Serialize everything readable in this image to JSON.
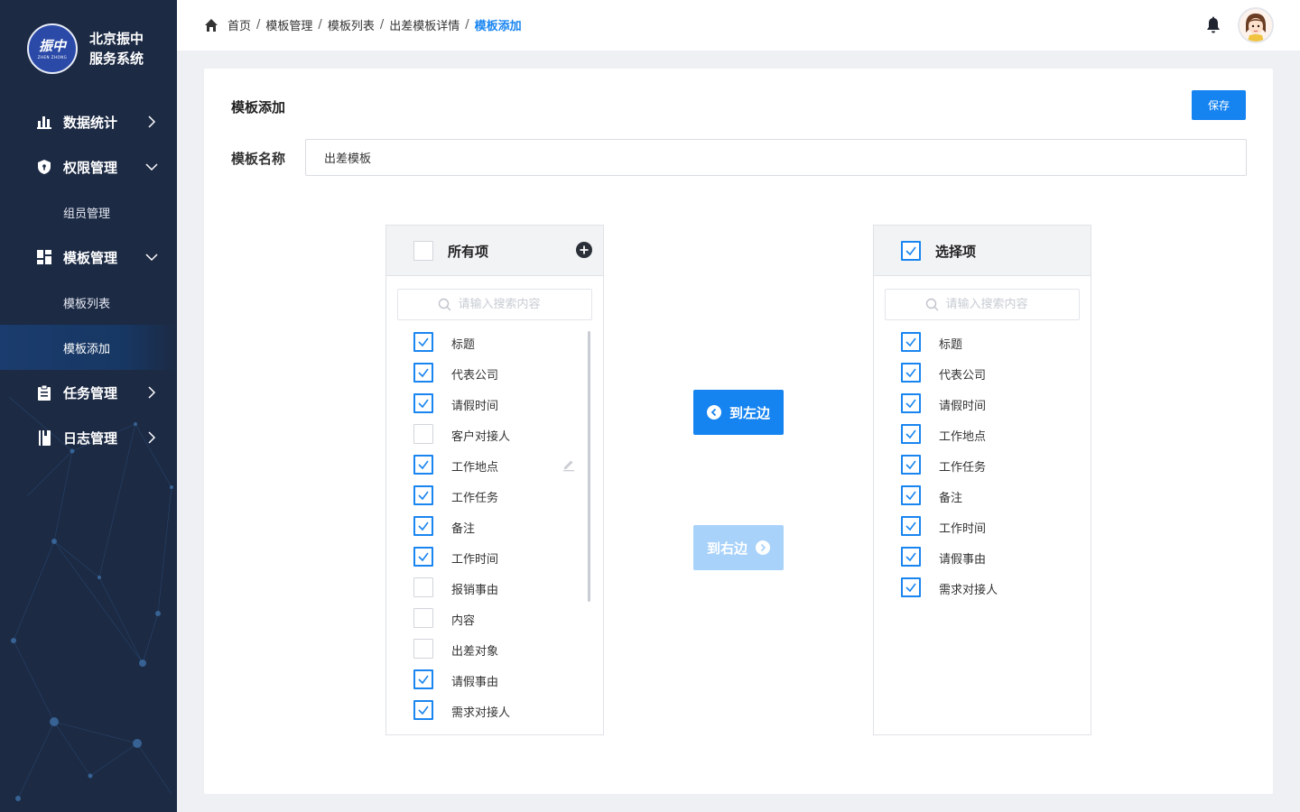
{
  "brand": {
    "logo_text": "振中",
    "logo_sub": "ZHEN ZHONG",
    "line1": "北京振中",
    "line2": "服务系统"
  },
  "sidebar": {
    "items": [
      {
        "label": "数据统计",
        "icon": "bar-chart-icon"
      },
      {
        "label": "权限管理",
        "icon": "shield-icon"
      },
      {
        "label": "组员管理"
      },
      {
        "label": "模板管理",
        "icon": "grid-icon"
      },
      {
        "label": "模板列表"
      },
      {
        "label": "模板添加",
        "active": true
      },
      {
        "label": "任务管理",
        "icon": "clipboard-icon"
      },
      {
        "label": "日志管理",
        "icon": "notebook-icon"
      }
    ]
  },
  "breadcrumb": {
    "items": [
      "首页",
      "模板管理",
      "模板列表",
      "出差模板详情"
    ],
    "current": "模板添加",
    "separator": "/"
  },
  "page": {
    "title": "模板添加",
    "save_label": "保存",
    "name_label": "模板名称",
    "name_value": "出差模板"
  },
  "left_panel": {
    "title": "所有项",
    "search_placeholder": "请输入搜索内容",
    "items": [
      {
        "label": "标题",
        "checked": true
      },
      {
        "label": "代表公司",
        "checked": true
      },
      {
        "label": "请假时间",
        "checked": true
      },
      {
        "label": "客户对接人",
        "checked": false
      },
      {
        "label": "工作地点",
        "checked": true
      },
      {
        "label": "工作任务",
        "checked": true
      },
      {
        "label": "备注",
        "checked": true
      },
      {
        "label": "工作时间",
        "checked": true
      },
      {
        "label": "报销事由",
        "checked": false
      },
      {
        "label": "内容",
        "checked": false
      },
      {
        "label": "出差对象",
        "checked": false
      },
      {
        "label": "请假事由",
        "checked": true
      },
      {
        "label": "需求对接人",
        "checked": true
      }
    ]
  },
  "right_panel": {
    "title": "选择项",
    "search_placeholder": "请输入搜索内容",
    "items": [
      {
        "label": "标题",
        "checked": true
      },
      {
        "label": "代表公司",
        "checked": true
      },
      {
        "label": "请假时间",
        "checked": true
      },
      {
        "label": "工作地点",
        "checked": true
      },
      {
        "label": "工作任务",
        "checked": true
      },
      {
        "label": "备注",
        "checked": true
      },
      {
        "label": "工作时间",
        "checked": true
      },
      {
        "label": "请假事由",
        "checked": true
      },
      {
        "label": "需求对接人",
        "checked": true
      }
    ]
  },
  "transfer": {
    "to_left_label": "到左边",
    "to_right_label": "到右边"
  },
  "colors": {
    "sidebar_bg": "#1c2a44",
    "accent": "#1583f0",
    "disabled_accent": "#a8d2fa"
  }
}
